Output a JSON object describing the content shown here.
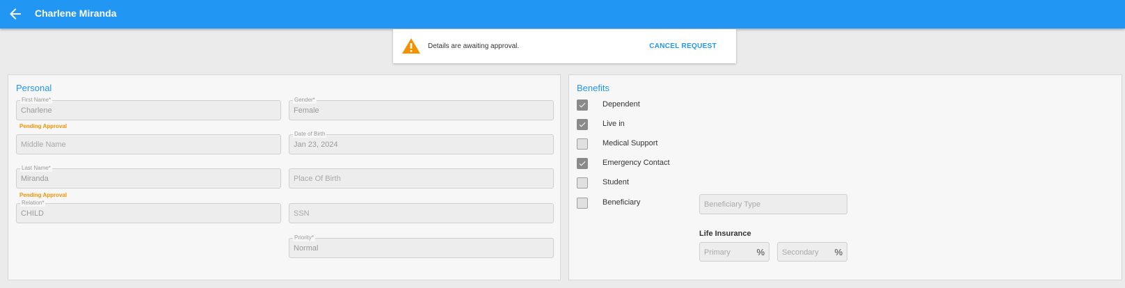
{
  "header": {
    "title": "Charlene Miranda",
    "back_icon": "arrow-back-icon"
  },
  "banner": {
    "message": "Details are awaiting approval.",
    "cancel_label": "CANCEL REQUEST",
    "warning_color": "#f39200"
  },
  "personal": {
    "title": "Personal",
    "first_name": {
      "label": "First Name*",
      "value": "Charlene",
      "status": "Pending Approval"
    },
    "middle_name": {
      "placeholder": "Middle Name"
    },
    "last_name": {
      "label": "Last Name*",
      "value": "Miranda",
      "status": "Pending Approval"
    },
    "relation": {
      "label": "Relation*",
      "value": "CHILD"
    },
    "gender": {
      "label": "Gender*",
      "value": "Female"
    },
    "dob": {
      "label": "Date of Birth",
      "value": "Jan 23, 2024"
    },
    "place_of_birth": {
      "placeholder": "Place Of Birth"
    },
    "ssn": {
      "placeholder": "SSN"
    },
    "priority": {
      "label": "Priority*",
      "value": "Normal"
    }
  },
  "benefits": {
    "title": "Benefits",
    "items": [
      {
        "label": "Dependent",
        "checked": true
      },
      {
        "label": "Live in",
        "checked": true
      },
      {
        "label": "Medical Support",
        "checked": false
      },
      {
        "label": "Emergency Contact",
        "checked": true
      },
      {
        "label": "Student",
        "checked": false
      },
      {
        "label": "Beneficiary",
        "checked": false
      }
    ],
    "beneficiary_type_placeholder": "Beneficiary Type",
    "life_insurance": {
      "title": "Life Insurance",
      "primary_placeholder": "Primary",
      "secondary_placeholder": "Secondary",
      "unit": "%"
    }
  },
  "colors": {
    "primary": "#2196f3",
    "pending": "#f39200"
  }
}
